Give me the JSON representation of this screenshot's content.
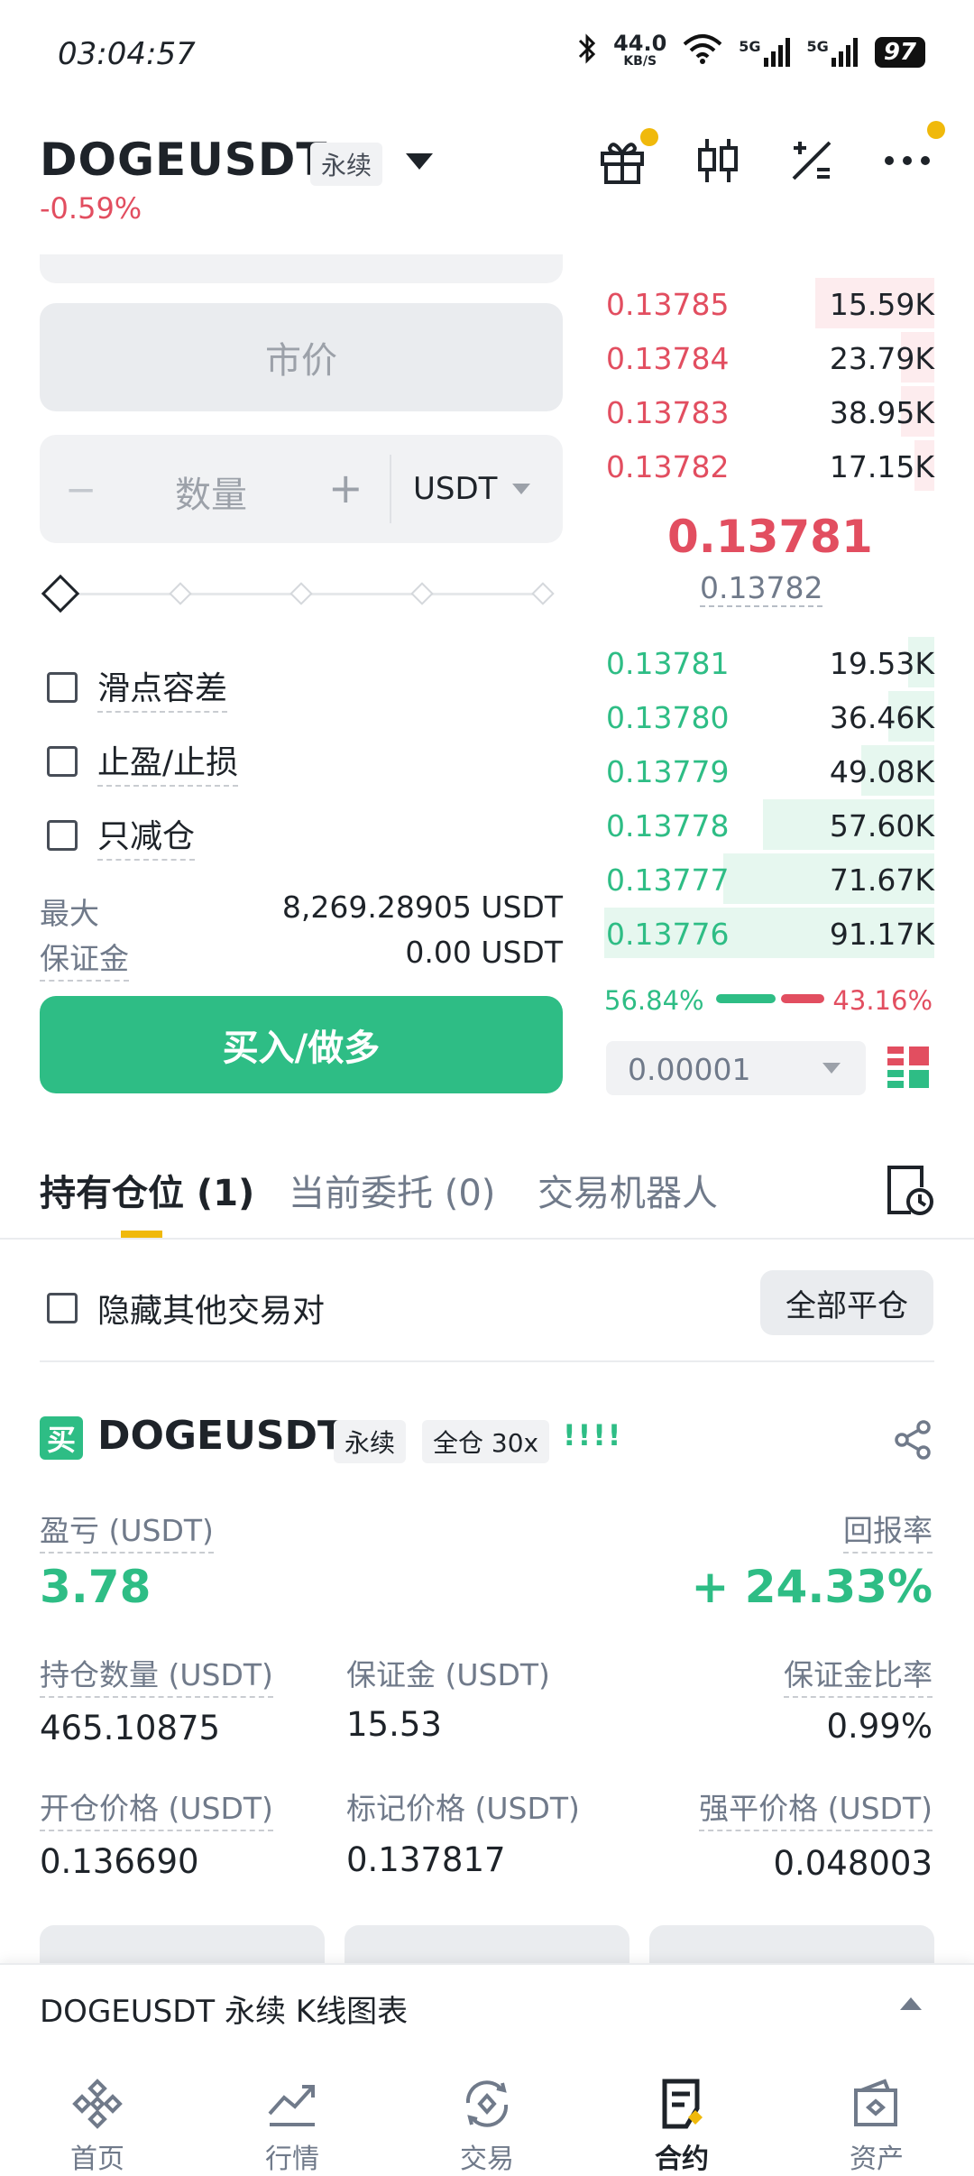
{
  "status_bar": {
    "time": "03:04:57",
    "speed_value": "44.0",
    "speed_unit": "KB/S",
    "net1": "5G",
    "net2": "5G",
    "battery": "97"
  },
  "header": {
    "symbol": "DOGEUSDT",
    "contract_type": "永续",
    "change_pct": "-0.59%"
  },
  "order_form": {
    "price_placeholder": "市价",
    "qty_minus": "−",
    "qty_placeholder": "数量",
    "qty_plus": "+",
    "qty_unit": "USDT",
    "options": [
      {
        "label": "滑点容差",
        "checked": false
      },
      {
        "label": "止盈/止损",
        "checked": false
      },
      {
        "label": "只减仓",
        "checked": false
      }
    ],
    "max_label": "最大",
    "max_value": "8,269.28905 USDT",
    "margin_label": "保证金",
    "margin_value": "0.00 USDT",
    "submit_label": "买入/做多"
  },
  "order_book": {
    "asks": [
      {
        "price": "0.13785",
        "qty": "15.59K",
        "depth": 0.36
      },
      {
        "price": "0.13784",
        "qty": "23.79K",
        "depth": 0.1
      },
      {
        "price": "0.13783",
        "qty": "38.95K",
        "depth": 0.1
      },
      {
        "price": "0.13782",
        "qty": "17.15K",
        "depth": 0.06
      }
    ],
    "last_price": "0.13781",
    "mark_price": "0.13782",
    "bids": [
      {
        "price": "0.13781",
        "qty": "19.53K",
        "depth": 0.08
      },
      {
        "price": "0.13780",
        "qty": "36.46K",
        "depth": 0.14
      },
      {
        "price": "0.13779",
        "qty": "49.08K",
        "depth": 0.22
      },
      {
        "price": "0.13778",
        "qty": "57.60K",
        "depth": 0.52
      },
      {
        "price": "0.13777",
        "qty": "71.67K",
        "depth": 0.64
      },
      {
        "price": "0.13776",
        "qty": "91.17K",
        "depth": 1.0
      }
    ],
    "buy_ratio": "56.84%",
    "sell_ratio": "43.16%",
    "tick_size": "0.00001",
    "colors": {
      "ask": "#e24e60",
      "bid": "#2ebd85",
      "ask_bg": "#fdecee",
      "bid_bg": "#e6f7ef"
    }
  },
  "tabs": [
    {
      "label": "持有仓位 (1)",
      "active": true
    },
    {
      "label": "当前委托 (0)",
      "active": false
    },
    {
      "label": "交易机器人",
      "active": false
    }
  ],
  "positions_toolbar": {
    "hide_others_label": "隐藏其他交易对",
    "close_all_label": "全部平仓"
  },
  "position": {
    "side_badge": "买",
    "symbol": "DOGEUSDT",
    "contract_type": "永续",
    "margin_mode": "全仓 30x",
    "bars": "!!!!",
    "pnl_label": "盈亏 (USDT)",
    "pnl_value": "3.78",
    "roe_label": "回报率",
    "roe_value": "+ 24.33%",
    "size_label": "持仓数量 (USDT)",
    "size_value": "465.10875",
    "margin_label": "保证金 (USDT)",
    "margin_value": "15.53",
    "margin_ratio_label": "保证金比率",
    "margin_ratio_value": "0.99%",
    "entry_label": "开仓价格 (USDT)",
    "entry_value": "0.136690",
    "mark_label": "标记价格 (USDT)",
    "mark_value": "0.137817",
    "liq_label": "强平价格 (USDT)",
    "liq_value": "0.048003"
  },
  "kline_bar": {
    "label": "DOGEUSDT 永续 K线图表"
  },
  "nav": [
    {
      "label": "首页",
      "icon": "home-icon",
      "active": false
    },
    {
      "label": "行情",
      "icon": "markets-icon",
      "active": false
    },
    {
      "label": "交易",
      "icon": "trade-icon",
      "active": false
    },
    {
      "label": "合约",
      "icon": "futures-icon",
      "active": true
    },
    {
      "label": "资产",
      "icon": "wallet-icon",
      "active": false
    }
  ],
  "accent": "#f0b90b"
}
